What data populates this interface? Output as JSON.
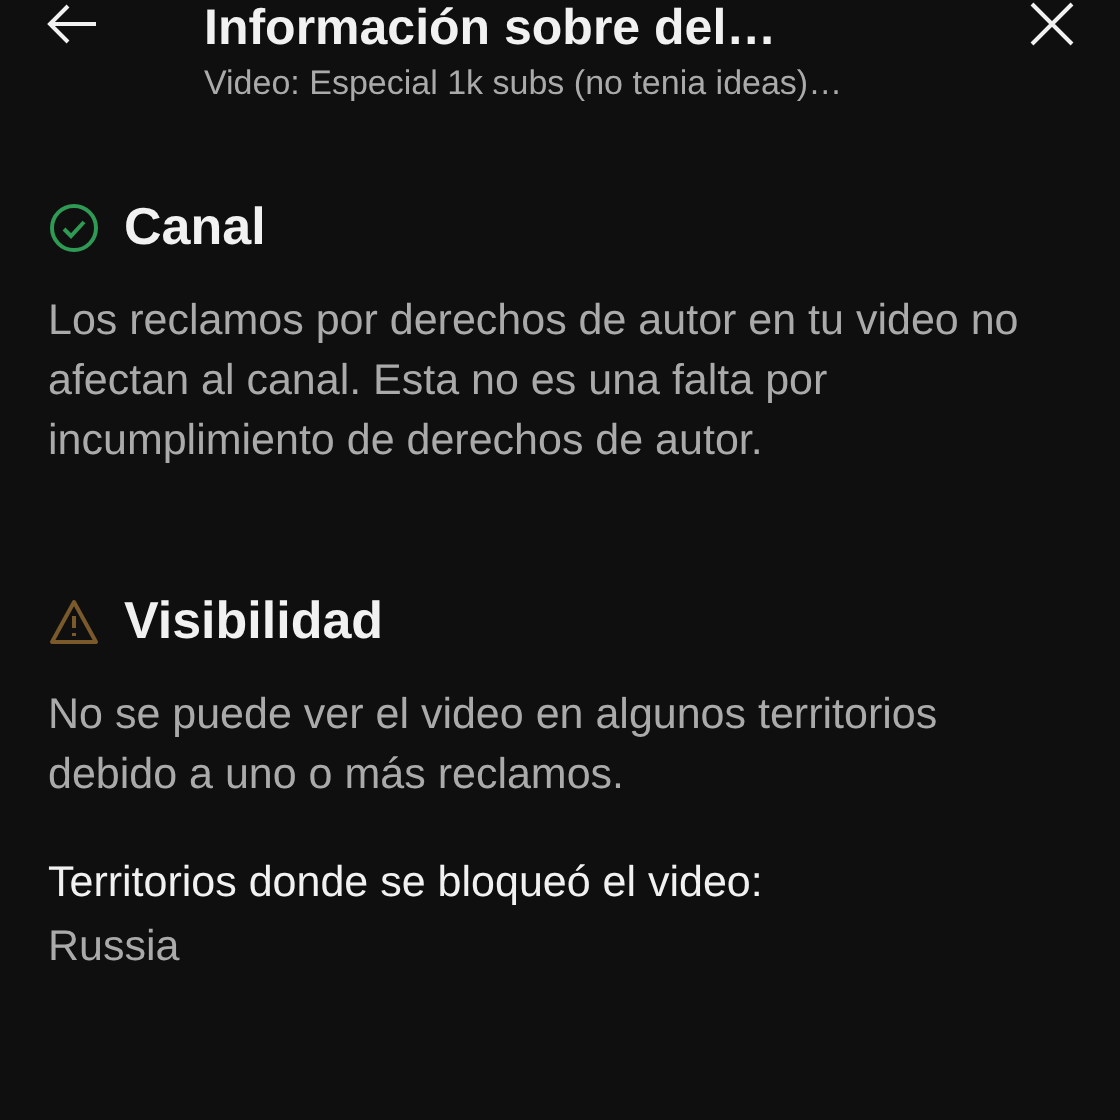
{
  "header": {
    "title": "Información sobre del…",
    "subtitle": "Video: Especial 1k subs (no tenia ideas)…"
  },
  "sections": [
    {
      "kind": "ok",
      "title": "Canal",
      "body": "Los reclamos por derechos de autor en tu video no afectan al canal. Esta no es una falta por incumplimiento de derechos de autor."
    },
    {
      "kind": "warning",
      "title": "Visibilidad",
      "body": "No se puede ver el video en algunos territorios debido a uno o más reclamos.",
      "detail_label": "Territorios donde se bloqueó el video:",
      "detail_value": "Russia"
    }
  ]
}
